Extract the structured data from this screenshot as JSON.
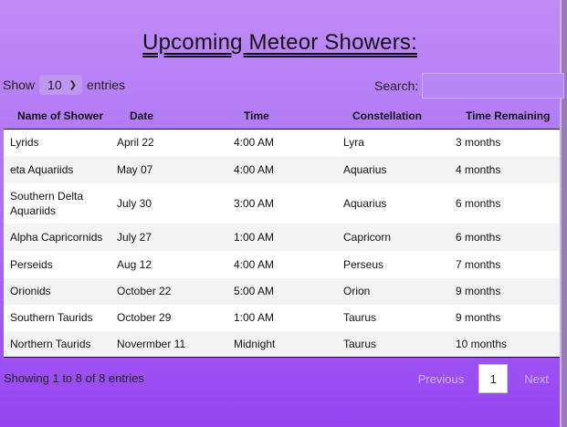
{
  "title": "Upcoming Meteor Showers:",
  "length": {
    "show_label": "Show",
    "value": "10",
    "entries_label": "entries"
  },
  "search": {
    "label": "Search:",
    "value": ""
  },
  "table": {
    "headers": [
      "Name of Shower",
      "Date",
      "Time",
      "Constellation",
      "Time Remaining"
    ],
    "rows": [
      [
        "Lyrids",
        "April 22",
        "4:00 AM",
        "Lyra",
        "3 months"
      ],
      [
        "eta Aquariids",
        "May 07",
        "4:00 AM",
        "Aquarius",
        "4 months"
      ],
      [
        "Southern Delta Aquariids",
        "July 30",
        "3:00 AM",
        "Aquarius",
        "6 months"
      ],
      [
        "Alpha Capricornids",
        "July 27",
        "1:00 AM",
        "Capricorn",
        "6 months"
      ],
      [
        "Perseids",
        "Aug 12",
        "4:00 AM",
        "Perseus",
        "7 months"
      ],
      [
        "Orionids",
        "October 22",
        "5:00 AM",
        "Orion",
        "9 months"
      ],
      [
        "Southern Taurids",
        "October 29",
        "1:00 AM",
        "Taurus",
        "9 months"
      ],
      [
        "Northern Taurids",
        "Novermber 11",
        "Midnight",
        "Taurus",
        "10 months"
      ]
    ]
  },
  "info": "Showing 1 to 8 of 8 entries",
  "pagination": {
    "previous": "Previous",
    "page": "1",
    "next": "Next"
  }
}
